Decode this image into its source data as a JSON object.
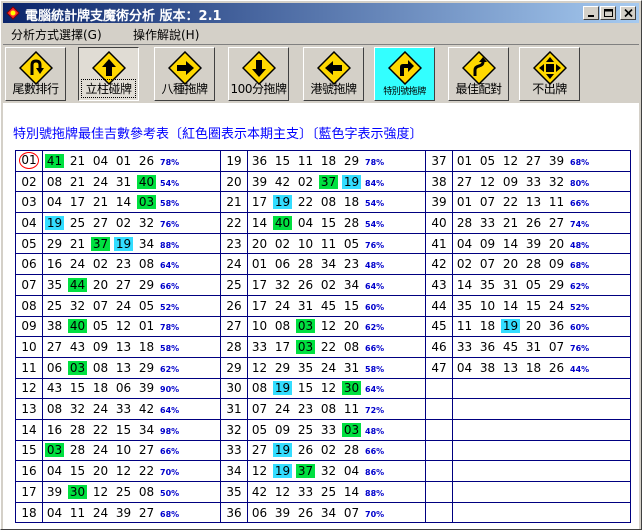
{
  "window": {
    "title": "電腦統計牌支魔術分析   版本：2.1",
    "controls": [
      "minimize",
      "maximize",
      "close"
    ]
  },
  "menu": [
    "分析方式選擇(G)",
    "操作解說(H)"
  ],
  "toolbar": [
    {
      "label": "尾數排行",
      "icon": "u-turn-sign-icon"
    },
    {
      "label": "立柱碰牌",
      "icon": "up-arrow-sign-icon",
      "state": "pressed"
    },
    {
      "label": "八種拖牌",
      "icon": "right-arrow-sign-icon"
    },
    {
      "label": "100分拖牌",
      "icon": "down-arrow-sign-icon"
    },
    {
      "label": "港號拖牌",
      "icon": "left-arrow-sign-icon"
    },
    {
      "label": "特別號拖牌",
      "icon": "turn-right-sign-icon",
      "state": "active"
    },
    {
      "label": "最佳配對",
      "icon": "curve-sign-icon"
    },
    {
      "label": "不出牌",
      "icon": "four-way-arrows-sign-icon"
    }
  ],
  "heading": "特別號拖牌最佳吉數參考表〔紅色圈表示本期主支〕〔藍色字表示強度〕",
  "colors": {
    "green": "#00e040",
    "cyan": "#33ddff",
    "circle": "#ff0000",
    "percent": "#0000cc",
    "heading": "#0000ff"
  },
  "rows": [
    [
      {
        "n": "01",
        "circled": true,
        "nums": [
          {
            "v": "41",
            "h": "g"
          },
          {
            "v": "21"
          },
          {
            "v": "04"
          },
          {
            "v": "01"
          },
          {
            "v": "26"
          }
        ],
        "p": "78%"
      },
      {
        "n": "19",
        "nums": [
          {
            "v": "36"
          },
          {
            "v": "15"
          },
          {
            "v": "11"
          },
          {
            "v": "18"
          },
          {
            "v": "29"
          }
        ],
        "p": "78%"
      },
      {
        "n": "37",
        "nums": [
          {
            "v": "01"
          },
          {
            "v": "05"
          },
          {
            "v": "12"
          },
          {
            "v": "27"
          },
          {
            "v": "39"
          }
        ],
        "p": "68%"
      }
    ],
    [
      {
        "n": "02",
        "nums": [
          {
            "v": "08"
          },
          {
            "v": "21"
          },
          {
            "v": "24"
          },
          {
            "v": "31"
          },
          {
            "v": "40",
            "h": "g"
          }
        ],
        "p": "54%"
      },
      {
        "n": "20",
        "nums": [
          {
            "v": "39"
          },
          {
            "v": "42"
          },
          {
            "v": "02"
          },
          {
            "v": "37",
            "h": "g"
          },
          {
            "v": "19",
            "h": "c"
          }
        ],
        "p": "84%"
      },
      {
        "n": "38",
        "nums": [
          {
            "v": "27"
          },
          {
            "v": "12"
          },
          {
            "v": "09"
          },
          {
            "v": "33"
          },
          {
            "v": "32"
          }
        ],
        "p": "80%"
      }
    ],
    [
      {
        "n": "03",
        "nums": [
          {
            "v": "04"
          },
          {
            "v": "17"
          },
          {
            "v": "21"
          },
          {
            "v": "14"
          },
          {
            "v": "03",
            "h": "g"
          }
        ],
        "p": "58%"
      },
      {
        "n": "21",
        "nums": [
          {
            "v": "17"
          },
          {
            "v": "19",
            "h": "c"
          },
          {
            "v": "22"
          },
          {
            "v": "08"
          },
          {
            "v": "18"
          }
        ],
        "p": "54%"
      },
      {
        "n": "39",
        "nums": [
          {
            "v": "01"
          },
          {
            "v": "07"
          },
          {
            "v": "22"
          },
          {
            "v": "13"
          },
          {
            "v": "11"
          }
        ],
        "p": "66%"
      }
    ],
    [
      {
        "n": "04",
        "nums": [
          {
            "v": "19",
            "h": "c"
          },
          {
            "v": "25"
          },
          {
            "v": "27"
          },
          {
            "v": "02"
          },
          {
            "v": "32"
          }
        ],
        "p": "76%"
      },
      {
        "n": "22",
        "nums": [
          {
            "v": "14"
          },
          {
            "v": "40",
            "h": "g"
          },
          {
            "v": "04"
          },
          {
            "v": "15"
          },
          {
            "v": "28"
          }
        ],
        "p": "54%"
      },
      {
        "n": "40",
        "nums": [
          {
            "v": "28"
          },
          {
            "v": "33"
          },
          {
            "v": "21"
          },
          {
            "v": "26"
          },
          {
            "v": "27"
          }
        ],
        "p": "74%"
      }
    ],
    [
      {
        "n": "05",
        "nums": [
          {
            "v": "29"
          },
          {
            "v": "21"
          },
          {
            "v": "37",
            "h": "g"
          },
          {
            "v": "19",
            "h": "c"
          },
          {
            "v": "34"
          }
        ],
        "p": "88%"
      },
      {
        "n": "23",
        "nums": [
          {
            "v": "20"
          },
          {
            "v": "02"
          },
          {
            "v": "10"
          },
          {
            "v": "11"
          },
          {
            "v": "05"
          }
        ],
        "p": "76%"
      },
      {
        "n": "41",
        "nums": [
          {
            "v": "04"
          },
          {
            "v": "09"
          },
          {
            "v": "14"
          },
          {
            "v": "39"
          },
          {
            "v": "20"
          }
        ],
        "p": "48%"
      }
    ],
    [
      {
        "n": "06",
        "nums": [
          {
            "v": "16"
          },
          {
            "v": "24"
          },
          {
            "v": "02"
          },
          {
            "v": "23"
          },
          {
            "v": "08"
          }
        ],
        "p": "64%"
      },
      {
        "n": "24",
        "nums": [
          {
            "v": "01"
          },
          {
            "v": "06"
          },
          {
            "v": "28"
          },
          {
            "v": "34"
          },
          {
            "v": "23"
          }
        ],
        "p": "48%"
      },
      {
        "n": "42",
        "nums": [
          {
            "v": "02"
          },
          {
            "v": "07"
          },
          {
            "v": "20"
          },
          {
            "v": "28"
          },
          {
            "v": "09"
          }
        ],
        "p": "68%"
      }
    ],
    [
      {
        "n": "07",
        "nums": [
          {
            "v": "35"
          },
          {
            "v": "44",
            "h": "g"
          },
          {
            "v": "20"
          },
          {
            "v": "27"
          },
          {
            "v": "29"
          }
        ],
        "p": "66%"
      },
      {
        "n": "25",
        "nums": [
          {
            "v": "17"
          },
          {
            "v": "32"
          },
          {
            "v": "26"
          },
          {
            "v": "02"
          },
          {
            "v": "34"
          }
        ],
        "p": "64%"
      },
      {
        "n": "43",
        "nums": [
          {
            "v": "14"
          },
          {
            "v": "35"
          },
          {
            "v": "31"
          },
          {
            "v": "05"
          },
          {
            "v": "29"
          }
        ],
        "p": "62%"
      }
    ],
    [
      {
        "n": "08",
        "nums": [
          {
            "v": "25"
          },
          {
            "v": "32"
          },
          {
            "v": "07"
          },
          {
            "v": "24"
          },
          {
            "v": "05"
          }
        ],
        "p": "52%"
      },
      {
        "n": "26",
        "nums": [
          {
            "v": "17"
          },
          {
            "v": "24"
          },
          {
            "v": "31"
          },
          {
            "v": "45"
          },
          {
            "v": "15"
          }
        ],
        "p": "60%"
      },
      {
        "n": "44",
        "nums": [
          {
            "v": "35"
          },
          {
            "v": "10"
          },
          {
            "v": "14"
          },
          {
            "v": "15"
          },
          {
            "v": "24"
          }
        ],
        "p": "52%"
      }
    ],
    [
      {
        "n": "09",
        "nums": [
          {
            "v": "38"
          },
          {
            "v": "40",
            "h": "g"
          },
          {
            "v": "05"
          },
          {
            "v": "12"
          },
          {
            "v": "01"
          }
        ],
        "p": "78%"
      },
      {
        "n": "27",
        "nums": [
          {
            "v": "10"
          },
          {
            "v": "08"
          },
          {
            "v": "03",
            "h": "g"
          },
          {
            "v": "12"
          },
          {
            "v": "20"
          }
        ],
        "p": "62%"
      },
      {
        "n": "45",
        "nums": [
          {
            "v": "11"
          },
          {
            "v": "18"
          },
          {
            "v": "19",
            "h": "c"
          },
          {
            "v": "20"
          },
          {
            "v": "36"
          }
        ],
        "p": "60%"
      }
    ],
    [
      {
        "n": "10",
        "nums": [
          {
            "v": "27"
          },
          {
            "v": "43"
          },
          {
            "v": "09"
          },
          {
            "v": "13"
          },
          {
            "v": "18"
          }
        ],
        "p": "58%"
      },
      {
        "n": "28",
        "nums": [
          {
            "v": "33"
          },
          {
            "v": "17"
          },
          {
            "v": "03",
            "h": "g"
          },
          {
            "v": "22"
          },
          {
            "v": "08"
          }
        ],
        "p": "66%"
      },
      {
        "n": "46",
        "nums": [
          {
            "v": "33"
          },
          {
            "v": "36"
          },
          {
            "v": "45"
          },
          {
            "v": "31"
          },
          {
            "v": "07"
          }
        ],
        "p": "76%"
      }
    ],
    [
      {
        "n": "11",
        "nums": [
          {
            "v": "06"
          },
          {
            "v": "03",
            "h": "g"
          },
          {
            "v": "08"
          },
          {
            "v": "13"
          },
          {
            "v": "29"
          }
        ],
        "p": "62%"
      },
      {
        "n": "29",
        "nums": [
          {
            "v": "12"
          },
          {
            "v": "29"
          },
          {
            "v": "35"
          },
          {
            "v": "24"
          },
          {
            "v": "31"
          }
        ],
        "p": "58%"
      },
      {
        "n": "47",
        "nums": [
          {
            "v": "04"
          },
          {
            "v": "38"
          },
          {
            "v": "13"
          },
          {
            "v": "18"
          },
          {
            "v": "26"
          }
        ],
        "p": "44%"
      }
    ],
    [
      {
        "n": "12",
        "nums": [
          {
            "v": "43"
          },
          {
            "v": "15"
          },
          {
            "v": "18"
          },
          {
            "v": "06"
          },
          {
            "v": "39"
          }
        ],
        "p": "90%"
      },
      {
        "n": "30",
        "nums": [
          {
            "v": "08"
          },
          {
            "v": "19",
            "h": "c"
          },
          {
            "v": "15"
          },
          {
            "v": "12"
          },
          {
            "v": "30",
            "h": "g"
          }
        ],
        "p": "64%"
      },
      {
        "empty": true
      }
    ],
    [
      {
        "n": "13",
        "nums": [
          {
            "v": "08"
          },
          {
            "v": "32"
          },
          {
            "v": "24"
          },
          {
            "v": "33"
          },
          {
            "v": "42"
          }
        ],
        "p": "64%"
      },
      {
        "n": "31",
        "nums": [
          {
            "v": "07"
          },
          {
            "v": "24"
          },
          {
            "v": "23"
          },
          {
            "v": "08"
          },
          {
            "v": "11"
          }
        ],
        "p": "72%"
      },
      {
        "empty": true
      }
    ],
    [
      {
        "n": "14",
        "nums": [
          {
            "v": "16"
          },
          {
            "v": "28"
          },
          {
            "v": "22"
          },
          {
            "v": "15"
          },
          {
            "v": "34"
          }
        ],
        "p": "98%"
      },
      {
        "n": "32",
        "nums": [
          {
            "v": "05"
          },
          {
            "v": "09"
          },
          {
            "v": "25"
          },
          {
            "v": "33"
          },
          {
            "v": "03",
            "h": "g"
          }
        ],
        "p": "48%"
      },
      {
        "empty": true
      }
    ],
    [
      {
        "n": "15",
        "nums": [
          {
            "v": "03",
            "h": "g"
          },
          {
            "v": "28"
          },
          {
            "v": "24"
          },
          {
            "v": "10"
          },
          {
            "v": "27"
          }
        ],
        "p": "66%"
      },
      {
        "n": "33",
        "nums": [
          {
            "v": "27"
          },
          {
            "v": "19",
            "h": "c"
          },
          {
            "v": "26"
          },
          {
            "v": "02"
          },
          {
            "v": "28"
          }
        ],
        "p": "66%"
      },
      {
        "empty": true
      }
    ],
    [
      {
        "n": "16",
        "nums": [
          {
            "v": "04"
          },
          {
            "v": "15"
          },
          {
            "v": "20"
          },
          {
            "v": "12"
          },
          {
            "v": "22"
          }
        ],
        "p": "70%"
      },
      {
        "n": "34",
        "nums": [
          {
            "v": "12"
          },
          {
            "v": "19",
            "h": "c"
          },
          {
            "v": "37",
            "h": "g"
          },
          {
            "v": "32"
          },
          {
            "v": "04"
          }
        ],
        "p": "86%"
      },
      {
        "empty": true
      }
    ],
    [
      {
        "n": "17",
        "nums": [
          {
            "v": "39"
          },
          {
            "v": "30",
            "h": "g"
          },
          {
            "v": "12"
          },
          {
            "v": "25"
          },
          {
            "v": "08"
          }
        ],
        "p": "50%"
      },
      {
        "n": "35",
        "nums": [
          {
            "v": "42"
          },
          {
            "v": "12"
          },
          {
            "v": "33"
          },
          {
            "v": "25"
          },
          {
            "v": "14"
          }
        ],
        "p": "88%"
      },
      {
        "empty": true
      }
    ],
    [
      {
        "n": "18",
        "nums": [
          {
            "v": "04"
          },
          {
            "v": "11"
          },
          {
            "v": "24"
          },
          {
            "v": "39"
          },
          {
            "v": "27"
          }
        ],
        "p": "68%"
      },
      {
        "n": "36",
        "nums": [
          {
            "v": "06"
          },
          {
            "v": "39"
          },
          {
            "v": "26"
          },
          {
            "v": "34"
          },
          {
            "v": "07"
          }
        ],
        "p": "70%"
      },
      {
        "empty": true
      }
    ]
  ]
}
